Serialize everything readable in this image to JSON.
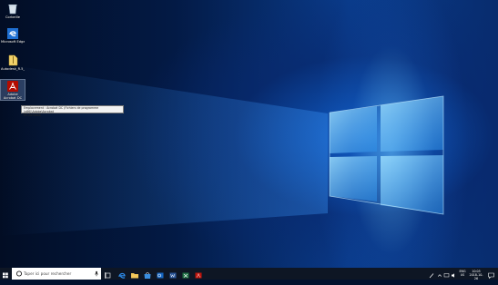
{
  "desktop": {
    "icons": [
      {
        "label": "Corbeille",
        "icon": "recycle-bin-icon"
      },
      {
        "label": "Microsoft Edge",
        "icon": "edge-icon"
      },
      {
        "label": "Autodesk_R.5_I...",
        "icon": "zip-folder-icon"
      },
      {
        "label": "Adobe Acrobat DC",
        "icon": "acrobat-icon"
      }
    ],
    "tooltip": {
      "line1": "Emplacement : Acrobat DC (Fichiers de programme (x86)\\Adobe\\Acrobat",
      "line2": "DC\\Acrobat)"
    }
  },
  "taskbar": {
    "search_placeholder": "Taper ici pour rechercher",
    "pinned": [
      {
        "name": "task-view",
        "icon": "task-view-icon"
      },
      {
        "name": "edge",
        "icon": "edge-icon"
      },
      {
        "name": "file-explorer",
        "icon": "folder-icon"
      },
      {
        "name": "store",
        "icon": "store-icon"
      },
      {
        "name": "outlook",
        "icon": "outlook-icon"
      },
      {
        "name": "word",
        "icon": "word-icon"
      },
      {
        "name": "excel",
        "icon": "excel-icon"
      },
      {
        "name": "acrobat",
        "icon": "acrobat-icon"
      }
    ],
    "tray": {
      "lang": "ENG",
      "region": "US",
      "time": "10:05",
      "date": "2018-10-26"
    }
  },
  "colors": {
    "taskbar_bg": "#0e1624",
    "accent": "#1e90ff"
  }
}
